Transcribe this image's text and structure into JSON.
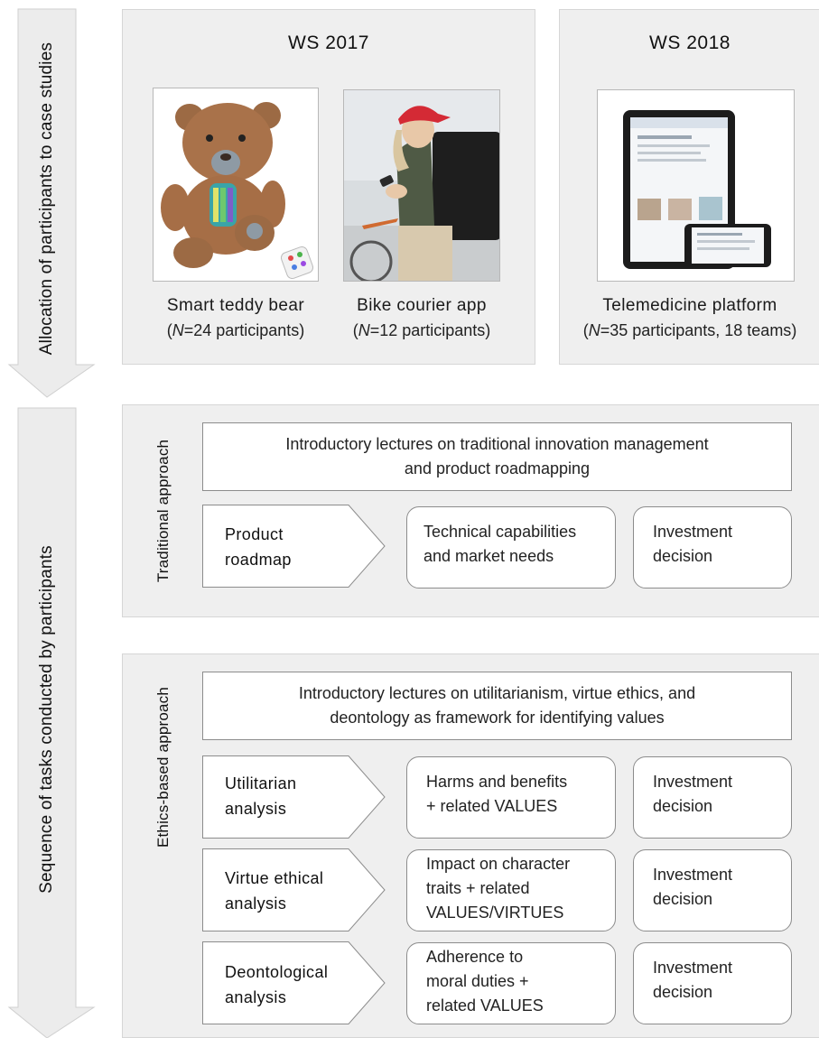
{
  "left_arrows": {
    "allocation_label": "Allocation of participants to case studies",
    "sequence_label": "Sequence of tasks conducted by participants"
  },
  "ws2017": {
    "title": "WS 2017",
    "cases": [
      {
        "name": "Smart teddy bear",
        "n_prefix": "N",
        "n_suffix": "=24 participants"
      },
      {
        "name": "Bike courier app",
        "n_prefix": "N",
        "n_suffix": "=12 participants"
      }
    ]
  },
  "ws2018": {
    "title": "WS 2018",
    "case": {
      "name": "Telemedicine platform",
      "n_prefix": "N",
      "n_suffix": "=35 participants, 18 teams"
    }
  },
  "traditional": {
    "side_label": "Traditional approach",
    "lecture": [
      "Introductory lectures on traditional innovation management",
      "and product roadmapping"
    ],
    "step": {
      "label": [
        "Product",
        "roadmap"
      ],
      "output": [
        "Technical capabilities",
        "and market needs"
      ],
      "decision": [
        "Investment",
        "decision"
      ]
    }
  },
  "ethics": {
    "side_label": "Ethics-based approach",
    "lecture": [
      "Introductory lectures on utilitarianism, virtue ethics, and",
      "deontology as framework for identifying values"
    ],
    "steps": [
      {
        "label": [
          "Utilitarian",
          "analysis"
        ],
        "output": [
          "Harms and benefits",
          "+ related VALUES"
        ],
        "decision": [
          "Investment",
          "decision"
        ]
      },
      {
        "label": [
          "Virtue ethical",
          "analysis"
        ],
        "output": [
          "Impact on character",
          "traits + related",
          "VALUES/VIRTUES"
        ],
        "decision": [
          "Investment",
          "decision"
        ]
      },
      {
        "label": [
          "Deontological",
          "analysis"
        ],
        "output": [
          "Adherence to",
          "moral duties +",
          "related VALUES"
        ],
        "decision": [
          "Investment",
          "decision"
        ]
      }
    ]
  }
}
